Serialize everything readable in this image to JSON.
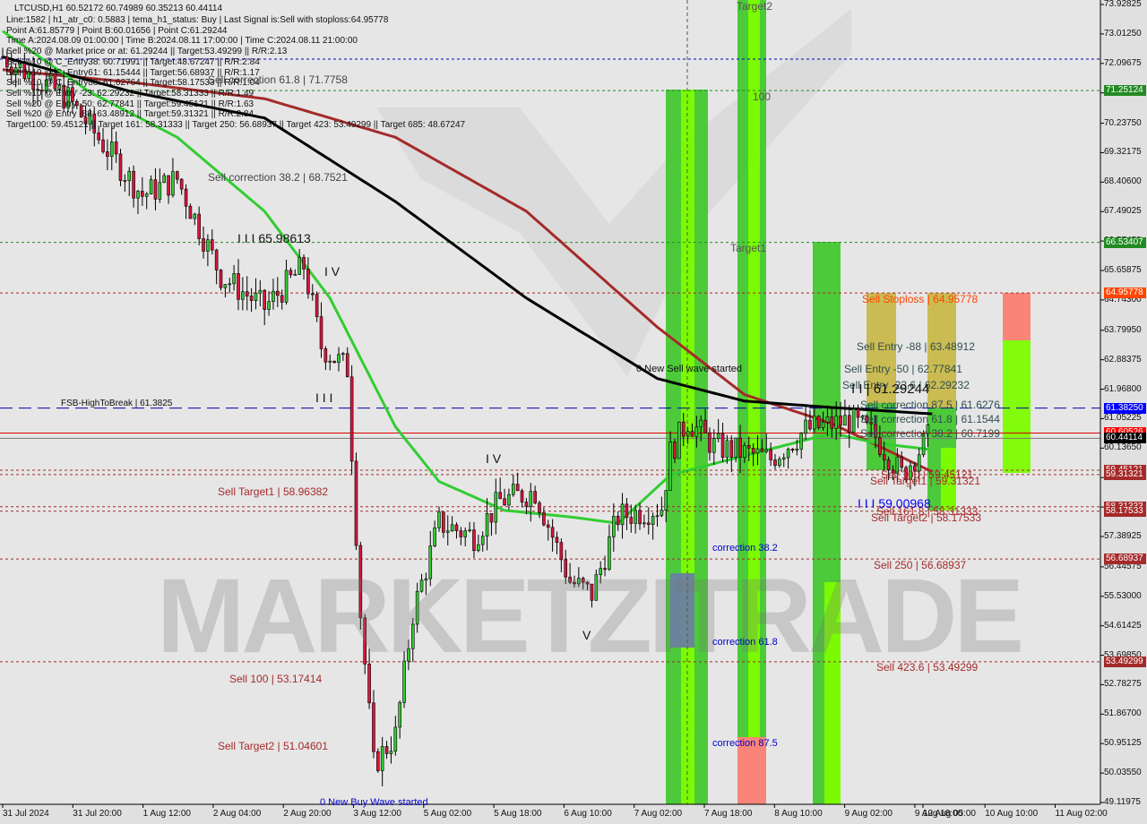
{
  "header": {
    "title": "LTCUSD,H1  60.52172 60.74989 60.35213 60.44114",
    "lines": [
      "Line:1582 | h1_atr_c0: 0.5883 | tema_h1_status: Buy | Last Signal is:Sell with stoploss:64.95778",
      "Point A:61.85779 | Point B:60.01656 | Point C:61.29244",
      "Time A:2024.08.09 01:00:00 | Time B:2024.08.11 17:00:00 | Time C:2024.08.11 21:00:00",
      "Sell %20 @ Market price or at: 61.29244 || Target:53.49299 || R/R:2.13",
      "Sell %10 @ C_Entry38: 60.71991 || Target:48.67247 || R/R:2.84",
      "Sell %10 @ C_Entry61: 61.15444 || Target:56.68937 || R/R:1.17",
      "Sell %10 @ C_Entry88: 61.62764 || Target:58.17533 || R/R:1.04",
      "Sell %10 @ Entry -23: 62.29232 || Target:58.31333 || R/R:1.49",
      "Sell %20 @ Entry -50: 62.77841 || Target:59.45121 || R/R:1.63",
      "Sell %20 @ Entry -88: 63.48912 || Target:59.31321 || R/R:2.84",
      "Target100: 59.45121 || Target 161: 58.31333 || Target 250: 56.68937 || Target 423: 53.49299 || Target 685: 48.67247"
    ]
  },
  "watermark": "MARKETZITRADE",
  "labels": {
    "sell_corr_618_top": "Sell correction 61.8 | 71.7758",
    "sell_corr_382_top": "Sell correction 38.2 | 68.7521",
    "wave_iii_top": "I I I 65.98613",
    "wave_iv_a": "I V",
    "fsb": "FSB-HighToBreak | 61.3825",
    "wave_iii_b": "I I I",
    "sell_target1_left": "Sell Target1 | 58.96382",
    "sell_100_left": "Sell 100 | 53.17414",
    "sell_target2_left": "Sell Target2 | 51.04601",
    "new_buy_wave": "0 New Buy Wave started",
    "new_sell_wave": "0 New Sell wave started",
    "wave_iv_b": "I V",
    "wave_v": "V",
    "target2": "Target2",
    "z100": "100",
    "target1": "Target1",
    "corr_382": "correction 38.2",
    "corr_618": "correction 61.8",
    "corr_875": "correction 87.5",
    "sell_stoploss": "Sell Stoploss | 64.95778",
    "sell_entry_88": "Sell Entry -88 | 63.48912",
    "sell_entry_50": "Sell Entry -50 | 62.77841",
    "sell_entry_236": "Sell Entry -23.6 | 62.29232",
    "wave_ii": "I I | 61.29244",
    "sell_corr_875": "Sell correction 87.5 | 61.6276",
    "sell_corr_618": "Sell correction 61.8 | 61.1544",
    "sell_corr_382": "Sell correction 38.2 | 60.7199",
    "sell_100_right": "Sell 100 | 59.45121",
    "sell_target1_right": "Sell Target1 | 59.31321",
    "wave_iii_right": "I I I 59.00968",
    "sell_1618": "Sell 161.8 | 58.31333",
    "sell_target2_right": "Sell Target2 | 58.17533",
    "sell_250": "Sell  250 | 56.68937",
    "sell_4236": "Sell  423.6 | 53.49299"
  },
  "chart_data": {
    "type": "candlestick",
    "symbol": "LTCUSD",
    "timeframe": "H1",
    "ylim": [
      49.11975,
      73.92825
    ],
    "y_ticks": [
      "73.92825",
      "73.01250",
      "72.09675",
      "71.18100",
      "70.23750",
      "69.32175",
      "68.40600",
      "67.49025",
      "66.57450",
      "65.65875",
      "64.74300",
      "63.79950",
      "62.88375",
      "61.96800",
      "61.05225",
      "60.13650",
      "59.22075",
      "58.30500",
      "57.38925",
      "56.44575",
      "55.53000",
      "54.61425",
      "53.69850",
      "52.78275",
      "51.86700",
      "50.95125",
      "50.03550",
      "49.11975"
    ],
    "x_ticks": [
      "31 Jul 2024",
      "31 Jul 20:00",
      "1 Aug 12:00",
      "2 Aug 04:00",
      "2 Aug 20:00",
      "3 Aug 12:00",
      "5 Aug 02:00",
      "5 Aug 18:00",
      "6 Aug 10:00",
      "7 Aug 02:00",
      "7 Aug 18:00",
      "8 Aug 10:00",
      "9 Aug 02:00",
      "9 Aug 18:00",
      "10 Aug 10:00",
      "11 Aug 02:00",
      "12 Aug 05:00"
    ],
    "price_keypoints": [
      [
        0,
        72.3
      ],
      [
        15,
        71.0
      ],
      [
        32,
        68.0
      ],
      [
        40,
        68.5
      ],
      [
        50,
        65.5
      ],
      [
        60,
        64.5
      ],
      [
        69,
        65.8
      ],
      [
        73,
        63.3
      ],
      [
        79,
        62.6
      ],
      [
        82,
        55.0
      ],
      [
        85,
        50.3
      ],
      [
        90,
        51.2
      ],
      [
        94,
        55.0
      ],
      [
        100,
        57.8
      ],
      [
        108,
        57.4
      ],
      [
        114,
        58.5
      ],
      [
        122,
        58.8
      ],
      [
        130,
        56.0
      ],
      [
        135,
        55.6
      ],
      [
        141,
        58.0
      ],
      [
        151,
        58.3
      ],
      [
        153,
        60.0
      ],
      [
        157,
        61.0
      ],
      [
        163,
        60.2
      ],
      [
        176,
        59.8
      ],
      [
        184,
        60.7
      ],
      [
        194,
        61.0
      ],
      [
        200,
        60.5
      ],
      [
        206,
        59.3
      ],
      [
        212,
        60.44
      ]
    ],
    "ma_black": [
      [
        0,
        72.3
      ],
      [
        30,
        71.2
      ],
      [
        60,
        70.4
      ],
      [
        90,
        67.8
      ],
      [
        120,
        64.8
      ],
      [
        150,
        62.3
      ],
      [
        170,
        61.6
      ],
      [
        190,
        61.4
      ],
      [
        213,
        61.2
      ]
    ],
    "ma_brown": [
      [
        0,
        71.9
      ],
      [
        30,
        71.5
      ],
      [
        60,
        71.0
      ],
      [
        90,
        69.8
      ],
      [
        120,
        67.5
      ],
      [
        150,
        63.9
      ],
      [
        170,
        61.8
      ],
      [
        190,
        60.9
      ],
      [
        213,
        59.4
      ]
    ],
    "ma_green": [
      [
        0,
        73.1
      ],
      [
        20,
        71.2
      ],
      [
        40,
        69.8
      ],
      [
        60,
        67.5
      ],
      [
        75,
        64.8
      ],
      [
        90,
        60.8
      ],
      [
        100,
        59.1
      ],
      [
        115,
        58.2
      ],
      [
        130,
        58.0
      ],
      [
        141,
        57.8
      ],
      [
        153,
        59.3
      ],
      [
        170,
        59.9
      ],
      [
        190,
        60.6
      ],
      [
        200,
        60.3
      ],
      [
        212,
        60.1
      ]
    ],
    "price_labels": [
      {
        "value": "71.25124",
        "color": "#228b22"
      },
      {
        "value": "66.53407",
        "color": "#228b22"
      },
      {
        "value": "64.95778",
        "color": "#ff4500"
      },
      {
        "value": "61.38250",
        "color": "#0000ff"
      },
      {
        "value": "60.60526",
        "color": "#ff0000"
      },
      {
        "value": "60.44114",
        "color": "#000000"
      },
      {
        "value": "59.45121",
        "color": "#a52a2a"
      },
      {
        "value": "59.31321",
        "color": "#a52a2a"
      },
      {
        "value": "58.31333",
        "color": "#a52a2a"
      },
      {
        "value": "58.17533",
        "color": "#a52a2a"
      },
      {
        "value": "56.68937",
        "color": "#a52a2a"
      },
      {
        "value": "53.49299",
        "color": "#a52a2a"
      }
    ],
    "hlines": [
      {
        "price": 72.23,
        "color": "#0000cc",
        "style": "dash"
      },
      {
        "price": 71.25124,
        "color": "#228b22",
        "style": "dash"
      },
      {
        "price": 66.53407,
        "color": "#228b22",
        "style": "dash"
      },
      {
        "price": 64.95778,
        "color": "#b22222",
        "style": "dash"
      },
      {
        "price": 61.3825,
        "color": "#0000aa",
        "style": "longdash"
      },
      {
        "price": 60.60526,
        "color": "#dd0000",
        "style": "solid"
      },
      {
        "price": 60.44114,
        "color": "#777777",
        "style": "solid"
      },
      {
        "price": 59.45121,
        "color": "#a52a2a",
        "style": "dash"
      },
      {
        "price": 59.31321,
        "color": "#a52a2a",
        "style": "dash"
      },
      {
        "price": 58.31333,
        "color": "#a52a2a",
        "style": "dash"
      },
      {
        "price": 58.17533,
        "color": "#a52a2a",
        "style": "dash"
      },
      {
        "price": 56.68937,
        "color": "#a52a2a",
        "style": "dash"
      },
      {
        "price": 53.49299,
        "color": "#a52a2a",
        "style": "dash"
      }
    ],
    "colors": {
      "bull": "#32cd32",
      "bear": "#dc143c",
      "zone_green": "#44c830",
      "zone_lime": "#7cfc00",
      "zone_salmon": "#fa8072",
      "zone_khaki": "#c8b84a"
    }
  }
}
